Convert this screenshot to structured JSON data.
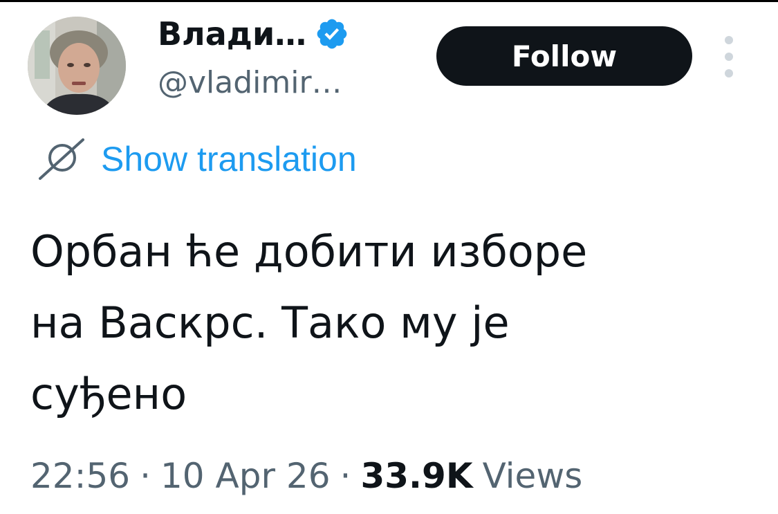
{
  "author": {
    "display_name": "Влади…",
    "handle": "@vladimir…",
    "verified_icon": "verified-badge-icon",
    "avatar_icon": "profile-photo"
  },
  "actions": {
    "follow_label": "Follow",
    "more_icon": "more-vertical-icon"
  },
  "translation": {
    "icon": "globe-icon",
    "label": "Show translation"
  },
  "tweet": {
    "lines": [
      "Орбан ће добити изборе",
      "на Васкрс. Тако му је",
      "суђено"
    ]
  },
  "meta": {
    "time": "22:56",
    "separator": "·",
    "date": "10 Apr 26",
    "views_count": "33.9K",
    "views_label": "Views"
  },
  "colors": {
    "accent": "#1d9bf0",
    "text_primary": "#0f1419",
    "text_secondary": "#536471",
    "button_bg": "#0f1419"
  }
}
